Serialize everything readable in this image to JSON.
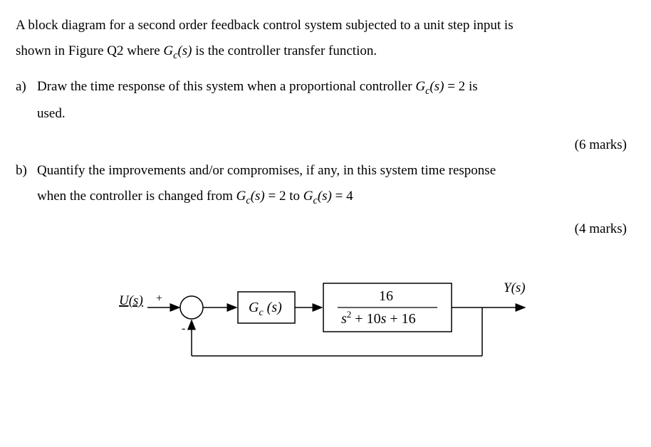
{
  "intro": {
    "line1_pre": "A block diagram for a second order feedback control system subjected to a unit step input is",
    "line2_pre": "shown in Figure Q2 where ",
    "gc_sym_html": "G",
    "gc_sub": "c",
    "gc_arg": "(s)",
    "line2_post": " is the controller transfer function."
  },
  "parts": {
    "a": {
      "label": "a)",
      "text_pre": "Draw the time response of this system when a proportional controller ",
      "eq": " = 2",
      "text_post": " is",
      "line2": "used.",
      "marks": "(6 marks)"
    },
    "b": {
      "label": "b)",
      "text1": "Quantify the improvements and/or compromises, if any, in this system time response",
      "text2_pre": "when the controller is changed from ",
      "eq1": " = 2 to ",
      "eq2": " = 4",
      "marks": "(4 marks)"
    }
  },
  "diagram": {
    "input_label": "U(s)",
    "sum_plus": "+",
    "sum_minus": "-",
    "block_gc": "G  (s)",
    "block_gc_sub": "c",
    "plant_numer": "16",
    "plant_denom_pre": "s",
    "plant_denom_sup": "2",
    "plant_denom_post": " + 10s + 16",
    "output_label": "Y(s)"
  }
}
